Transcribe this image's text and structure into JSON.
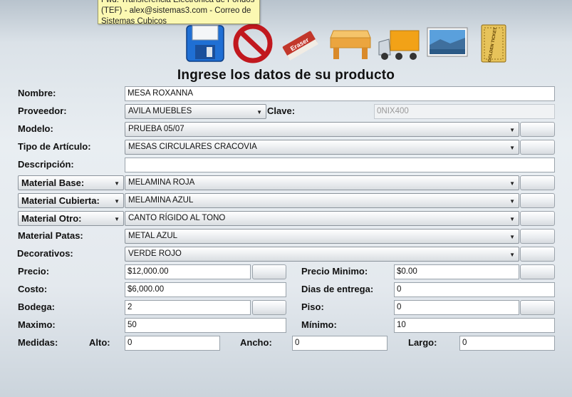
{
  "tooltip": {
    "line1": "Fwd: Transferencia Electrónica de Fondos",
    "line2": "(TEF) - alex@sistemas3.com - Correo de",
    "line3": "Sistemas Cubicos"
  },
  "toolbar": {
    "icons": [
      "save-disk-icon",
      "cancel-no-icon",
      "eraser-icon",
      "table-icon",
      "truck-icon",
      "landscape-picture-icon",
      "golden-ticket-icon"
    ],
    "eraser_text": "Eraser",
    "ticket_text": "GOLDEN TICKET"
  },
  "title": "Ingrese los datos de su producto",
  "form": {
    "nombre": {
      "label": "Nombre:",
      "value": "MESA ROXANNA"
    },
    "proveedor": {
      "label": "Proveedor:",
      "value": "AVILA MUEBLES"
    },
    "clave": {
      "label": "Clave:",
      "value": "0NIX400"
    },
    "modelo": {
      "label": "Modelo:",
      "value": "PRUEBA 05/07"
    },
    "tipo": {
      "label": "Tipo de Artículo:",
      "value": "MESAS CIRCULARES CRACOVIA"
    },
    "descripcion": {
      "label": "Descripción:",
      "value": ""
    },
    "material_base": {
      "label": "Material Base:",
      "value": "MELAMINA ROJA"
    },
    "material_cubierta": {
      "label": "Material Cubierta:",
      "value": "MELAMINA AZUL"
    },
    "material_otro": {
      "label": "Material Otro:",
      "value": "CANTO RÍGIDO AL TONO"
    },
    "material_patas": {
      "label": "Material Patas:",
      "value": "METAL  AZUL"
    },
    "decorativos": {
      "label": "Decorativos:",
      "value": "VERDE ROJO"
    },
    "precio": {
      "label": "Precio:",
      "value": "$12,000.00"
    },
    "precio_minimo": {
      "label": "Precio Minimo:",
      "value": "$0.00"
    },
    "costo": {
      "label": "Costo:",
      "value": "$6,000.00"
    },
    "dias_entrega": {
      "label": "Dias de entrega:",
      "value": "0"
    },
    "bodega": {
      "label": "Bodega:",
      "value": "2"
    },
    "piso": {
      "label": "Piso:",
      "value": "0"
    },
    "maximo": {
      "label": "Maximo:",
      "value": "50"
    },
    "minimo": {
      "label": "Mínimo:",
      "value": "10"
    },
    "medidas": {
      "label": "Medidas:"
    },
    "alto": {
      "label": "Alto:",
      "value": "0"
    },
    "ancho": {
      "label": "Ancho:",
      "value": "0"
    },
    "largo": {
      "label": "Largo:",
      "value": "0"
    }
  }
}
